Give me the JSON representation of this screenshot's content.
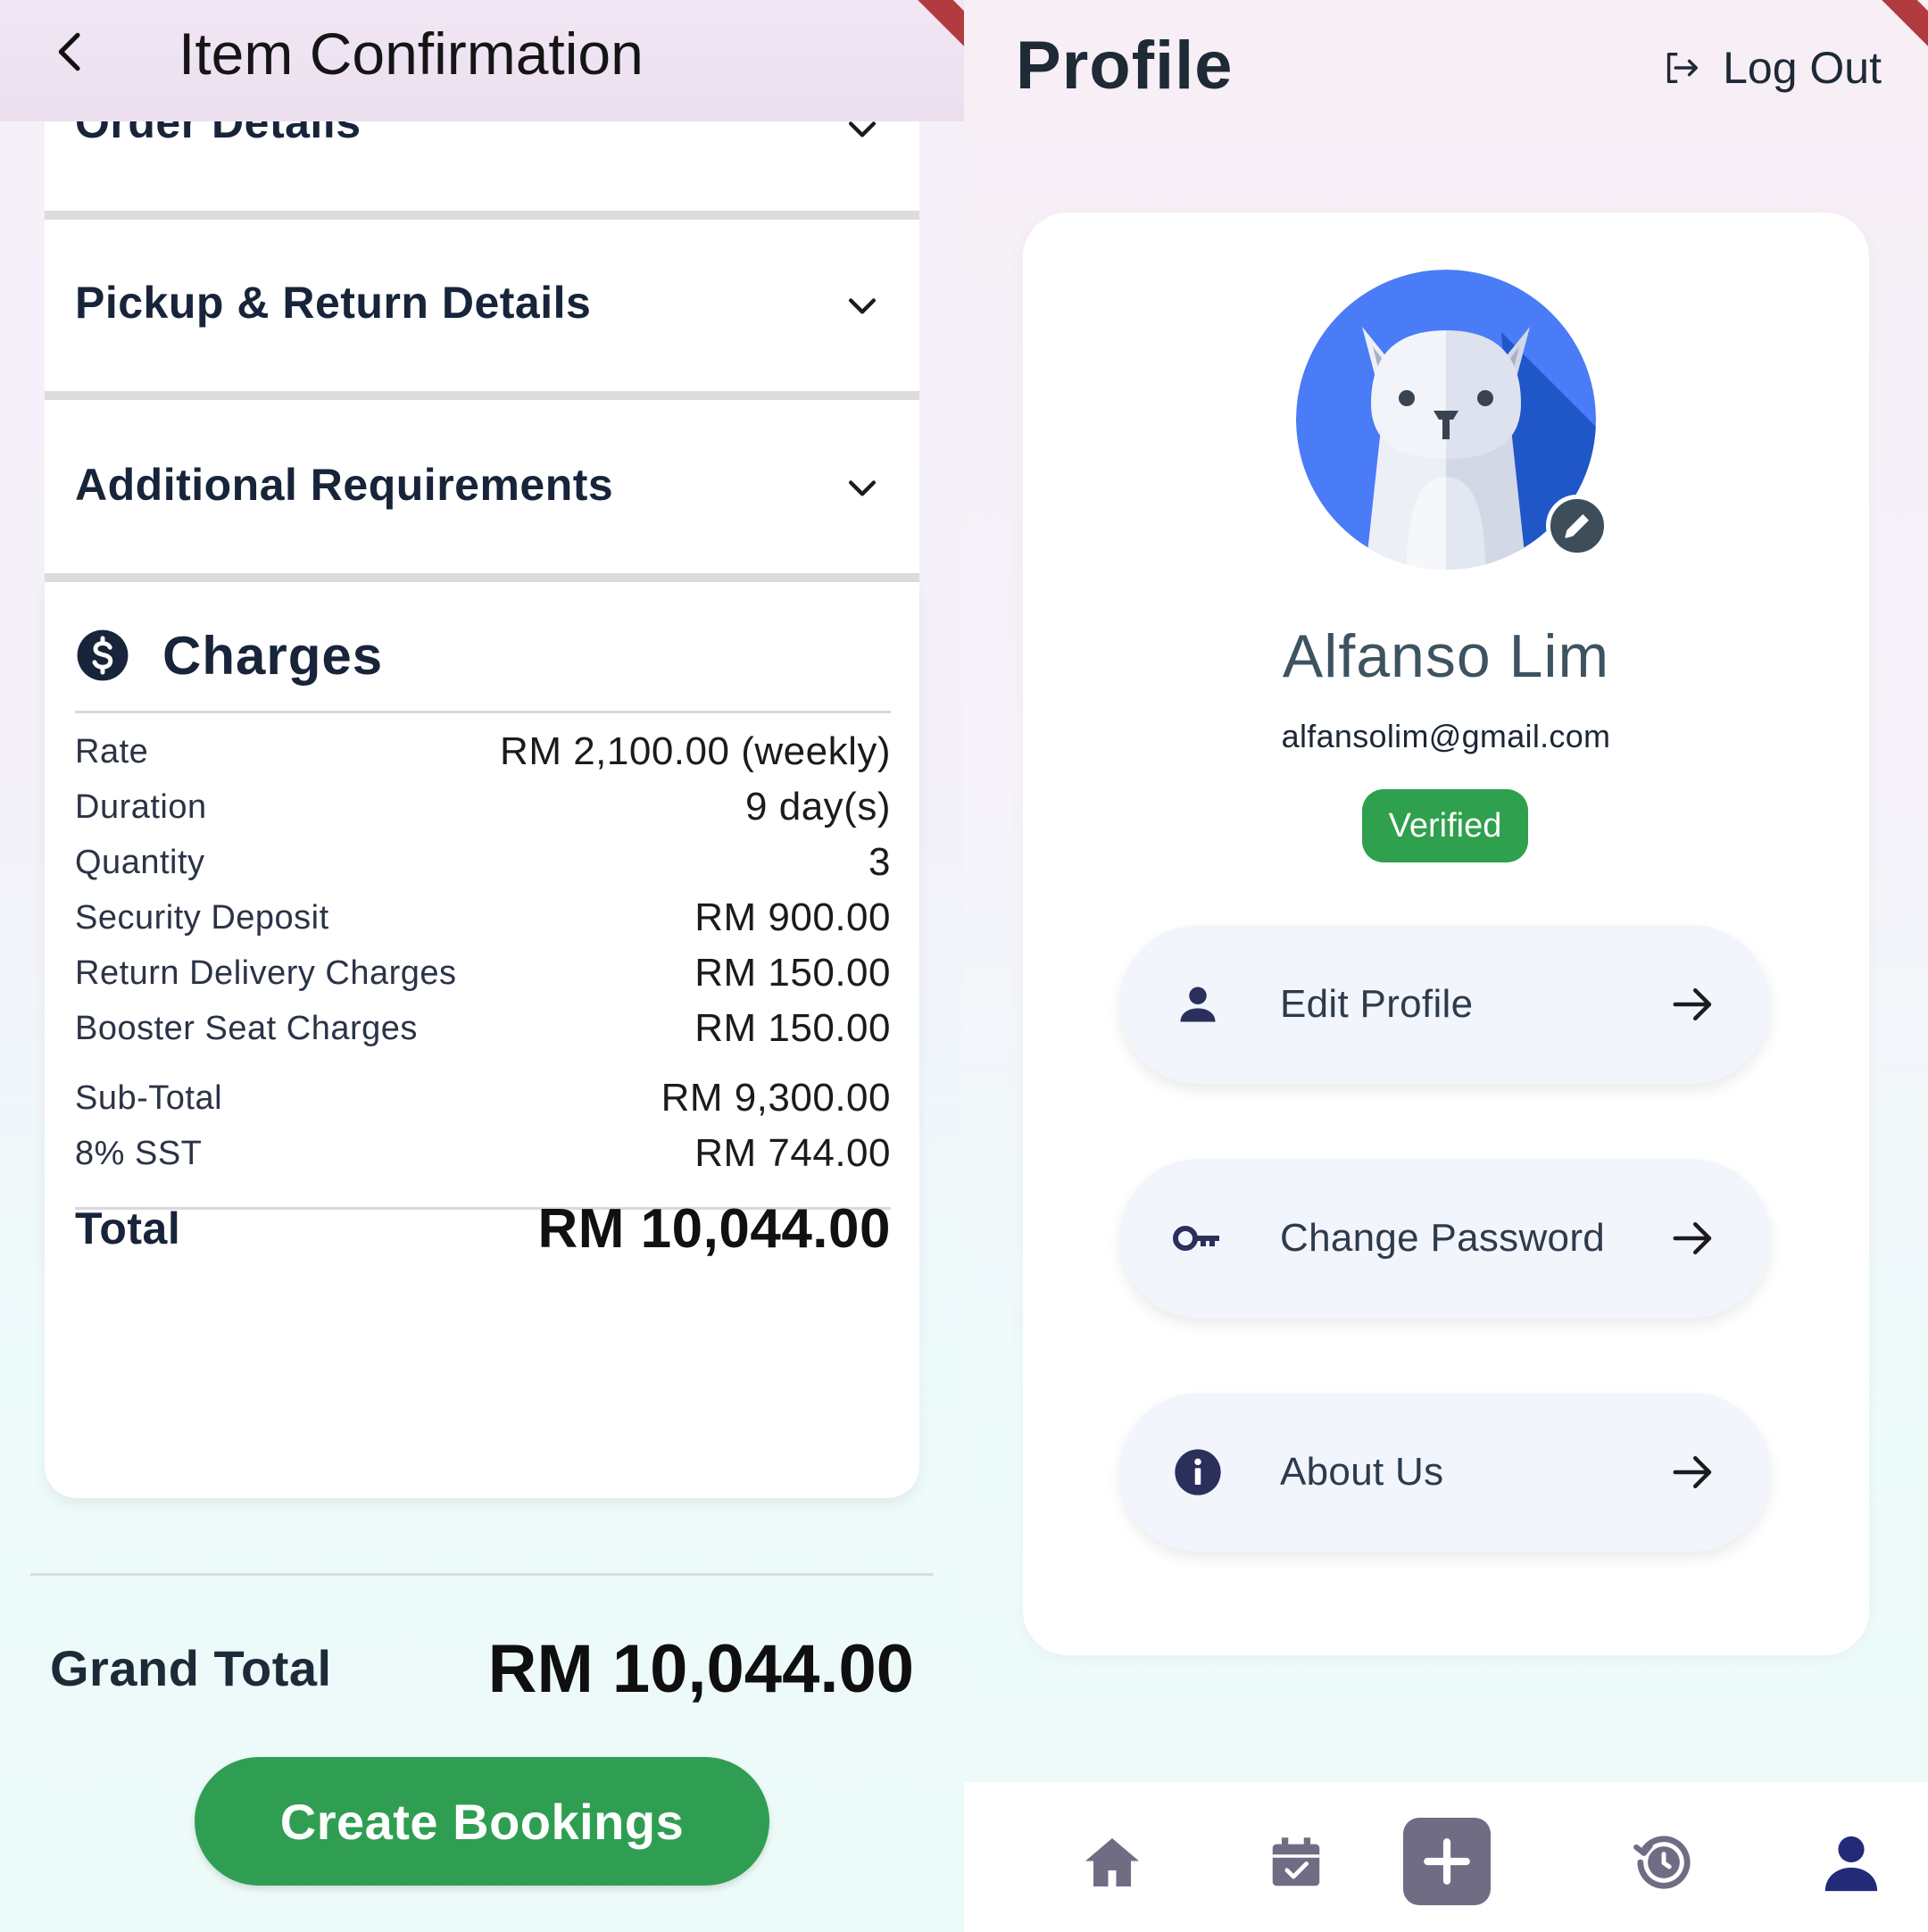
{
  "left_screen": {
    "title": "Item Confirmation",
    "sections": {
      "order_details": "Order Details",
      "pickup_return": "Pickup & Return Details",
      "additional": "Additional Requirements"
    },
    "charges": {
      "title": "Charges",
      "rows": [
        {
          "label": "Rate",
          "value": "RM 2,100.00 (weekly)"
        },
        {
          "label": "Duration",
          "value": "9 day(s)"
        },
        {
          "label": "Quantity",
          "value": "3"
        },
        {
          "label": "Security Deposit",
          "value": "RM 900.00"
        },
        {
          "label": "Return Delivery Charges",
          "value": "RM 150.00"
        },
        {
          "label": "Booster Seat Charges",
          "value": "RM 150.00"
        }
      ],
      "subtotal": {
        "label": "Sub-Total",
        "value": "RM 9,300.00"
      },
      "tax": {
        "label": "8% SST",
        "value": "RM 744.00"
      },
      "total": {
        "label": "Total",
        "value": "RM 10,044.00"
      }
    },
    "grand_total": {
      "label": "Grand Total",
      "value": "RM 10,044.00"
    },
    "create_button": "Create Bookings"
  },
  "right_screen": {
    "title": "Profile",
    "logout_label": "Log Out",
    "user": {
      "name": "Alfanso Lim",
      "email": "alfansolim@gmail.com",
      "status": "Verified"
    },
    "menu": [
      {
        "label": "Edit Profile",
        "icon": "person-icon"
      },
      {
        "label": "Change Password",
        "icon": "key-icon"
      },
      {
        "label": "About Us",
        "icon": "info-icon"
      }
    ],
    "nav": [
      "home-icon",
      "calendar-check-icon",
      "add-icon",
      "history-icon",
      "person-icon"
    ]
  },
  "colors": {
    "accent_green": "#2f9e52",
    "heading_navy": "#17243a",
    "icon_navy": "#2a2f5c",
    "avatar_blue": "#4a7cf7",
    "nav_gray": "#6f6c84",
    "ribbon_red": "#b13b3e"
  }
}
